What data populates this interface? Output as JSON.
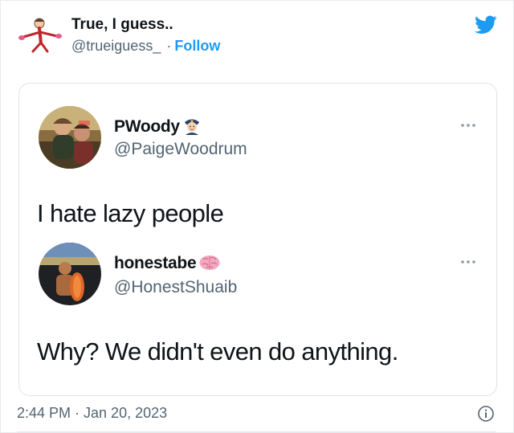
{
  "header": {
    "display_name": "True, I guess..",
    "handle": "@trueiguess_",
    "separator": "·",
    "follow_label": "Follow",
    "avatar_icon": "stick-figure-avatar-icon",
    "brand_icon": "twitter-bird-icon",
    "brand_color": "#1d9bf0"
  },
  "posts": [
    {
      "display_name": "PWoody",
      "name_emoji": "police-officer-emoji-icon",
      "handle": "@PaigeWoodrum",
      "text": "I hate lazy people",
      "more_icon": "more-dots-icon"
    },
    {
      "display_name": "honestabe",
      "name_emoji": "brain-emoji-icon",
      "handle": "@HonestShuaib",
      "text": "Why? We didn't even do anything.",
      "more_icon": "more-dots-icon"
    }
  ],
  "footer": {
    "timestamp": "2:44 PM · Jan 20, 2023",
    "info_icon": "info-icon"
  }
}
